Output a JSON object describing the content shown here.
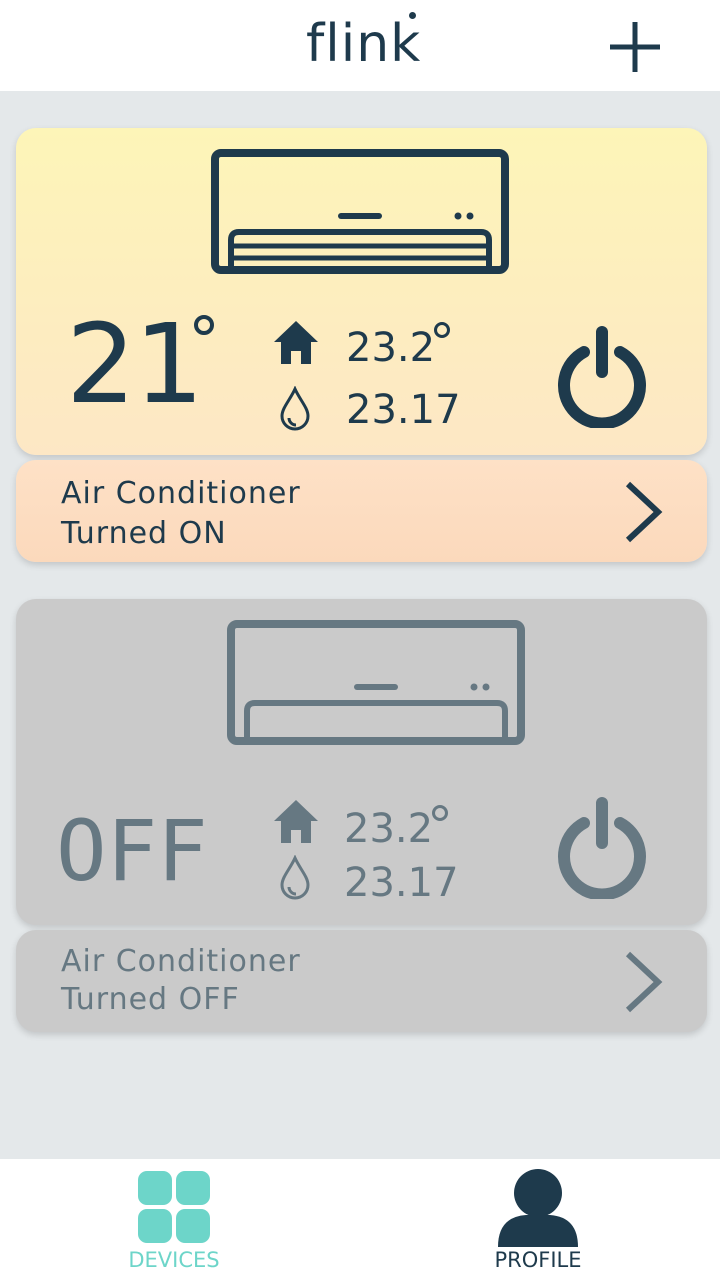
{
  "header": {
    "logo": "flink"
  },
  "devices": [
    {
      "state": "on",
      "setpoint": "21",
      "room_temp": "23.2",
      "humidity": "23.17",
      "title": "Air Conditioner",
      "status": "Turned ON"
    },
    {
      "state": "off",
      "setpoint_text": "OFF",
      "room_temp": "23.2",
      "humidity": "23.17",
      "title": "Air Conditioner",
      "status": "Turned OFF"
    }
  ],
  "nav": {
    "devices_label": "DEVICES",
    "profile_label": "PROFILE"
  },
  "colors": {
    "dark": "#1e3a4c",
    "muted": "#667882",
    "accent": "#6dd5c9"
  }
}
